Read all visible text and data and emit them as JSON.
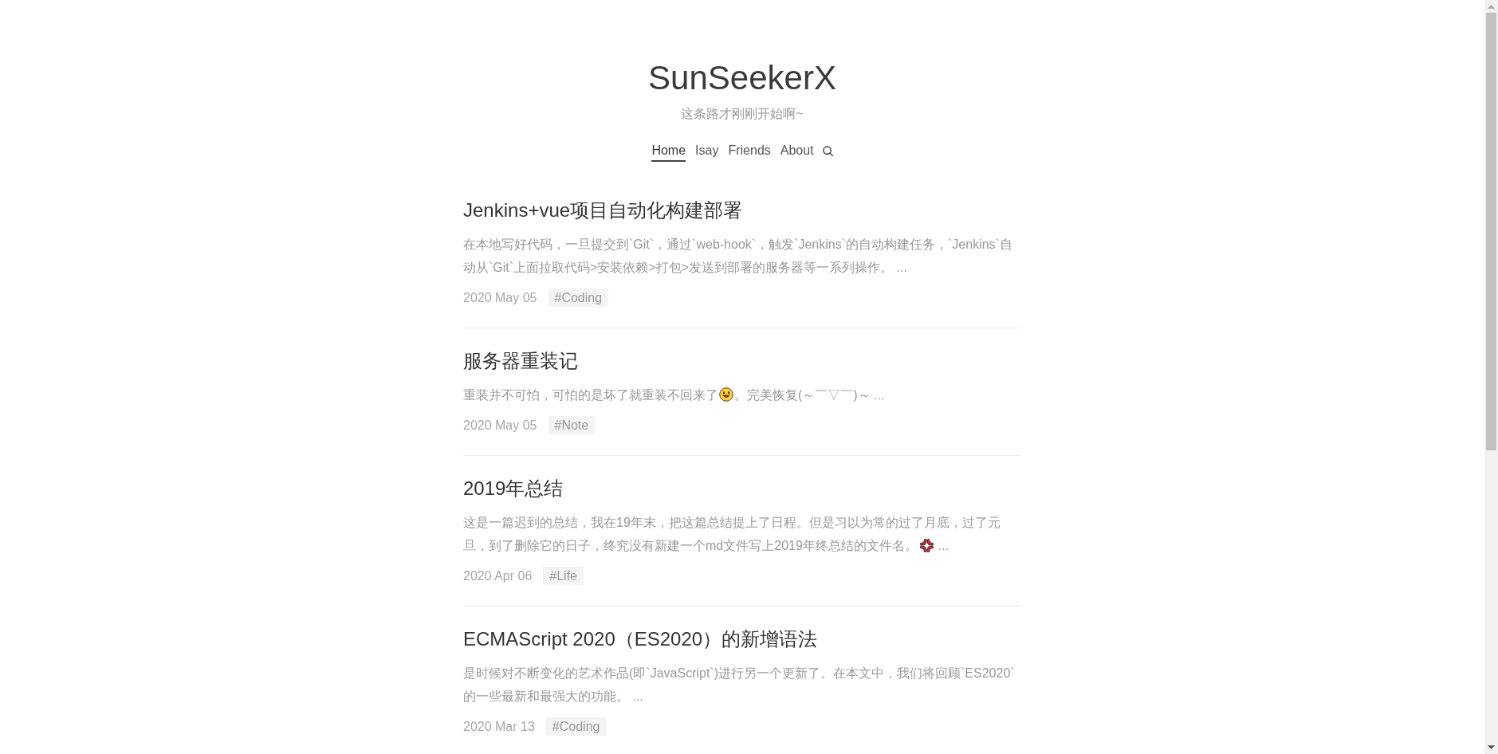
{
  "site": {
    "title": "SunSeekerX",
    "subtitle": "这条路才刚刚开始啊~"
  },
  "nav": [
    {
      "label": "Home",
      "selected": true
    },
    {
      "label": "Isay",
      "selected": false
    },
    {
      "label": "Friends",
      "selected": false
    },
    {
      "label": "About",
      "selected": false
    }
  ],
  "posts": [
    {
      "title": "Jenkins+vue项目自动化构建部署",
      "excerpt": [
        {
          "kind": "text",
          "text": "在本地写好代码，一旦提交到`Git`，通过`web-hook`，触发`Jenkins`的自动构建任务，`Jenkins`自动从`Git`上面拉取代码>安装依赖>打包>发送到部署的服务器等一系列操作。 ..."
        }
      ],
      "date": "2020 May 05",
      "tag": "#Coding"
    },
    {
      "title": "服务器重装记",
      "excerpt": [
        {
          "kind": "text",
          "text": "重装并不可怕，可怕的是坏了就重装不回来了"
        },
        {
          "kind": "smiley"
        },
        {
          "kind": "text",
          "text": "。完美恢复(～￣▽￣)～ ..."
        }
      ],
      "date": "2020 May 05",
      "tag": "#Note"
    },
    {
      "title": "2019年总结",
      "excerpt": [
        {
          "kind": "line",
          "text": "这是一篇迟到的总结，我在19年末，把这篇总结提上了日程。但是习以为常的过了月底，过了元"
        },
        {
          "kind": "text",
          "text": "旦，到了删除它的日子，终究没有新建一个md文件写上2019年终总结的文件名。"
        },
        {
          "kind": "anger"
        },
        {
          "kind": "text",
          "text": "..."
        }
      ],
      "date": "2020 Apr 06",
      "tag": "#Life"
    },
    {
      "title": "ECMAScript 2020（ES2020）的新增语法",
      "excerpt": [
        {
          "kind": "text",
          "text": "是时候对不断变化的艺术作品(即`JavaScript`)进行另一个更新了。在本文中，我们将回顾`ES2020`的一些最新和最强大的功能。 ..."
        }
      ],
      "date": "2020 Mar 13",
      "tag": "#Coding"
    }
  ]
}
